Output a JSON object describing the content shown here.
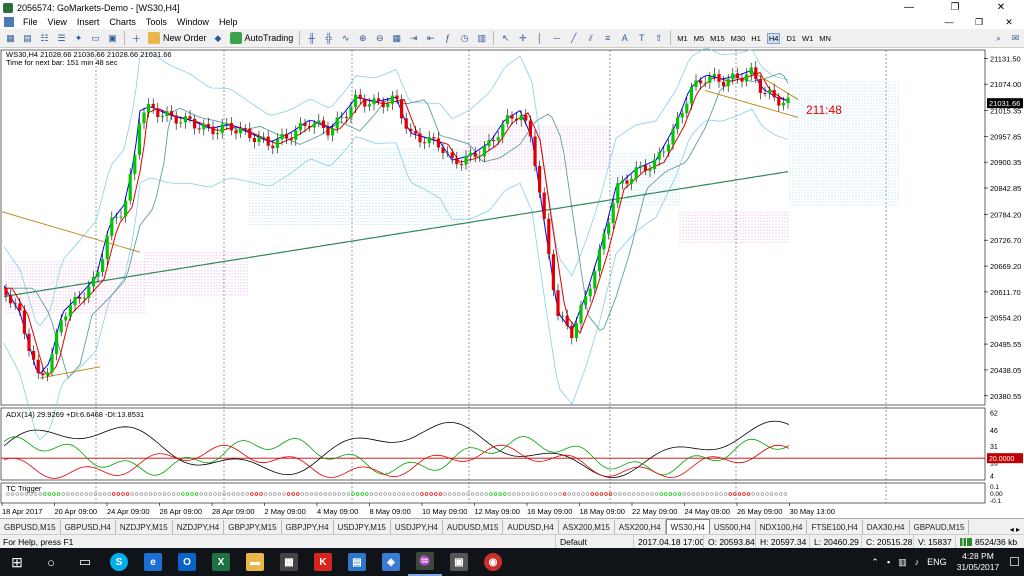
{
  "window": {
    "title": "2056574: GoMarkets-Demo - [WS30,H4]",
    "controls": [
      "—",
      "❐",
      "✕"
    ]
  },
  "menu": {
    "items": [
      "File",
      "View",
      "Insert",
      "Charts",
      "Tools",
      "Window",
      "Help"
    ],
    "mdi_controls": [
      "—",
      "❐",
      "✕"
    ]
  },
  "toolbar": {
    "new_order_label": "New Order",
    "autotrading_label": "AutoTrading",
    "timeframes": [
      "M1",
      "M5",
      "M15",
      "M30",
      "H1",
      "H4",
      "D1",
      "W1",
      "MN"
    ],
    "active_timeframe": "H4"
  },
  "chart": {
    "header": "WS30,H4  21028.66 21036.66 21028.66 21031.66",
    "subheader": "Time for next bar: 151 min 48 sec",
    "countdown_label": "211:48",
    "current_price": "21031.66",
    "price_ticks": [
      "21131.50",
      "21074.00",
      "21015.35",
      "20957.85",
      "20900.35",
      "20842.85",
      "20784.20",
      "20726.70",
      "20669.20",
      "20611.70",
      "20554.20",
      "20495.55",
      "20438.05",
      "20380.55"
    ],
    "time_ticks": [
      "18 Apr 2017",
      "20 Apr 09:00",
      "24 Apr 09:00",
      "26 Apr 09:00",
      "28 Apr 09:00",
      "2 May 09:00",
      "4 May 09:00",
      "8 May 09:00",
      "10 May 09:00",
      "12 May 09:00",
      "16 May 09:00",
      "18 May 09:00",
      "22 May 09:00",
      "24 May 09:00",
      "26 May 09:00",
      "30 May 13:00"
    ],
    "adx_header": "ADX(14) 29.9269 +DI:6.6468 -DI:13.8531",
    "adx_ticks": [
      "62",
      "46",
      "31",
      "16",
      "4"
    ],
    "adx_level": "20.0000",
    "tc_header": "TC Trigger",
    "tc_ticks": [
      "0.1",
      "0.00",
      "-0.1"
    ],
    "colors": {
      "bull": "#00c800",
      "bear": "#e00000",
      "wick": "#000000",
      "ma_fast": "#0000ff",
      "ma_red": "#e00000",
      "ma_green": "#2e8b57",
      "bands": "#87ceeb",
      "adx": "#000000",
      "pdi": "#00a000",
      "mdi": "#e00000",
      "level": "#c00000",
      "cloud_up": "#87ceeb",
      "cloud_down": "#dd88dd"
    }
  },
  "tabs": {
    "items": [
      "GBPUSD,M15",
      "GBPUSD,H4",
      "NZDJPY,M15",
      "NZDJPY,H4",
      "GBPJPY,M15",
      "GBPJPY,H4",
      "USDJPY,M15",
      "USDJPY,H4",
      "AUDUSD,M15",
      "AUDUSD,H4",
      "ASX200,M15",
      "ASX200,H4",
      "WS30,H4",
      "US500,H4",
      "NDX100,H4",
      "FTSE100,H4",
      "DAX30,H4",
      "GBPAUD,M15"
    ],
    "active": "WS30,H4"
  },
  "status": {
    "help": "For Help, press F1",
    "profile": "Default",
    "datetime": "2017.04.18 17:00",
    "open": "O: 20593.84",
    "high": "H: 20597.34",
    "low": "L: 20460.29",
    "close": "C: 20515.28",
    "volume": "V: 15837",
    "traffic": "8524/36 kb"
  },
  "taskbar": {
    "lang": "ENG",
    "time": "4:28 PM",
    "date": "31/05/2017"
  }
}
